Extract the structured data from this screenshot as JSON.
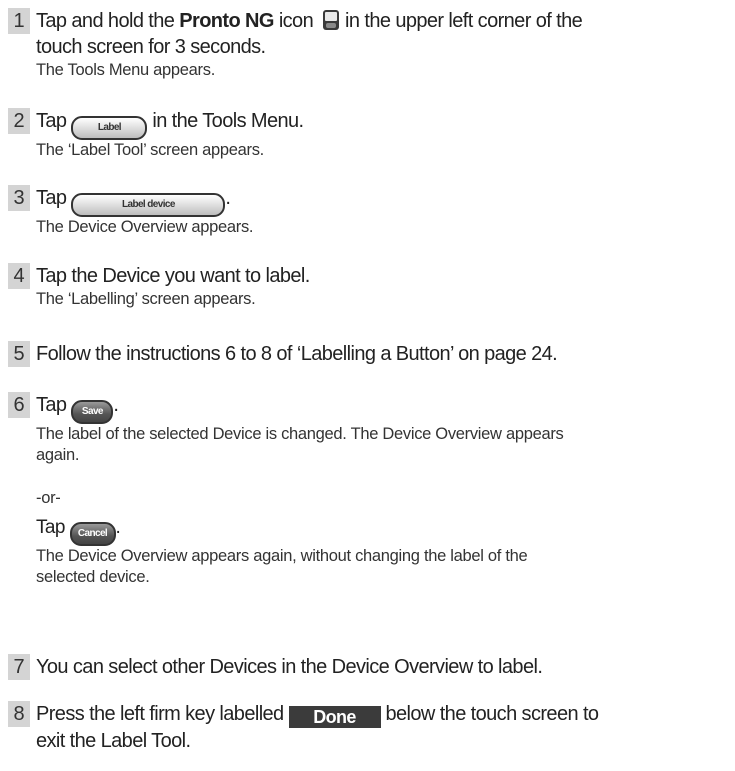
{
  "steps": [
    {
      "num": "1",
      "instr_pre": "Tap and hold the ",
      "instr_bold": "Pronto NG",
      "instr_mid": " icon",
      "icon": "pronto-device-icon",
      "instr_post_line1": " in the upper left corner of the",
      "instr_line2": "touch screen for 3 seconds.",
      "result": "The Tools Menu appears."
    },
    {
      "num": "2",
      "instr_pre": "Tap ",
      "button": "Label",
      "instr_post": " in the Tools Menu.",
      "result": "The ‘Label Tool’ screen appears."
    },
    {
      "num": "3",
      "instr_pre": "Tap ",
      "button": "Label device",
      "instr_post": ".",
      "result": "The Device Overview appears."
    },
    {
      "num": "4",
      "instr": "Tap the Device you want to label.",
      "result": "The ‘Labelling’ screen appears."
    },
    {
      "num": "5",
      "instr": "Follow the instructions 6 to 8 of ‘Labelling a Button’ on page 24."
    },
    {
      "num": "6",
      "instr_pre": "Tap ",
      "button": "Save",
      "instr_post": ".",
      "result_line1": "The label of the selected Device is changed. The Device Overview appears",
      "result_line2": "again.",
      "or_text": "-or-",
      "alt_pre": "Tap ",
      "alt_button": "Cancel",
      "alt_post": ".",
      "alt_result_line1": "The Device Overview appears again, without changing the label of the",
      "alt_result_line2": "selected device."
    },
    {
      "num": "7",
      "instr": "You can select other Devices in the Device Overview to label."
    },
    {
      "num": "8",
      "instr_pre": "Press the left firm key labelled ",
      "firm_key": "Done",
      "instr_post": " below the touch screen to",
      "instr_line2": "exit the Label Tool."
    }
  ]
}
